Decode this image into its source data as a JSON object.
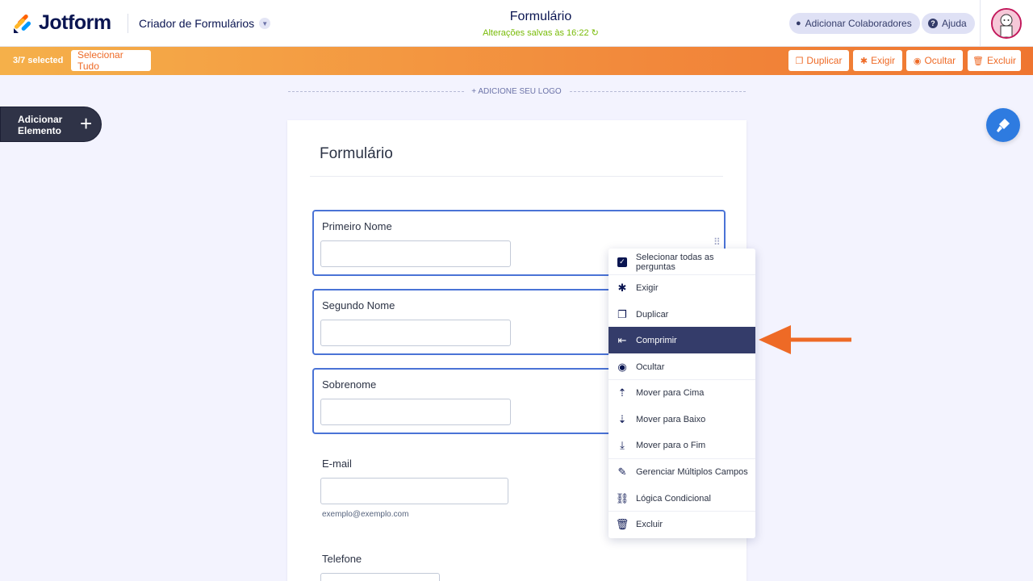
{
  "header": {
    "logo_text": "Jotform",
    "builder_label": "Criador de Formulários",
    "form_title": "Formulário",
    "saved_status": "Alterações salvas às 16:22",
    "add_collaborators": "Adicionar Colaboradores",
    "help": "Ajuda"
  },
  "toolbar": {
    "selection_count": "3/7 selected",
    "select_all": "Selecionar Tudo",
    "duplicate": "Duplicar",
    "require": "Exigir",
    "hide": "Ocultar",
    "delete": "Excluir"
  },
  "canvas": {
    "add_logo": "+ ADICIONE SEU LOGO",
    "add_element_line1": "Adicionar",
    "add_element_line2": "Elemento"
  },
  "form": {
    "title": "Formulário",
    "fields": [
      {
        "label": "Primeiro Nome",
        "selected": true
      },
      {
        "label": "Segundo Nome",
        "selected": true
      },
      {
        "label": "Sobrenome",
        "selected": true
      },
      {
        "label": "E-mail",
        "sublabel": "exemplo@exemplo.com",
        "selected": false
      },
      {
        "label": "Telefone",
        "selected": false
      }
    ]
  },
  "context_menu": {
    "items": [
      {
        "label": "Selecionar todas as perguntas",
        "icon": "checkbox-icon"
      },
      {
        "label": "Exigir",
        "icon": "asterisk-icon"
      },
      {
        "label": "Duplicar",
        "icon": "duplicate-icon"
      },
      {
        "label": "Comprimir",
        "icon": "shrink-icon",
        "active": true
      },
      {
        "label": "Ocultar",
        "icon": "eye-off-icon"
      },
      {
        "label": "Mover para Cima",
        "icon": "move-up-icon"
      },
      {
        "label": "Mover para Baixo",
        "icon": "move-down-icon"
      },
      {
        "label": "Mover para o Fim",
        "icon": "move-end-icon"
      },
      {
        "label": "Gerenciar Múltiplos Campos",
        "icon": "pencil-icon"
      },
      {
        "label": "Lógica Condicional",
        "icon": "logic-icon"
      },
      {
        "label": "Excluir",
        "icon": "trash-icon"
      }
    ]
  },
  "colors": {
    "accent_orange": "#ef7530",
    "selection_blue": "#4a73d6",
    "menu_active": "#343c6a",
    "saved_green": "#78bb07"
  }
}
